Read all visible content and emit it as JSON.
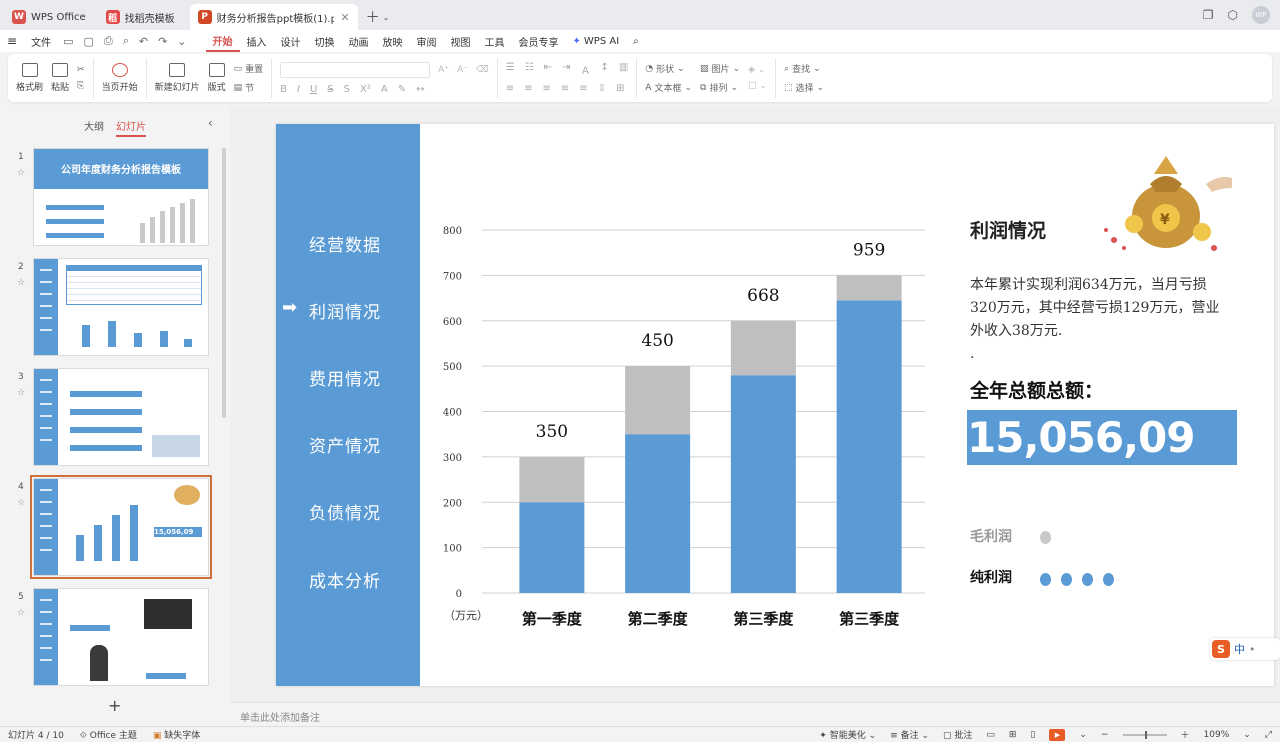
{
  "titlebar": {
    "tabs": [
      {
        "label": "WPS Office",
        "icon": "wps-logo-icon",
        "color": "#d9534f"
      },
      {
        "label": "找稻壳模板",
        "icon": "docer-icon",
        "color": "#e0484a"
      },
      {
        "label": "财务分析报告ppt模板(1).pptx",
        "icon": "presentation-icon",
        "color": "#d24726"
      }
    ]
  },
  "menubar": {
    "file": "文件",
    "items": [
      "开始",
      "插入",
      "设计",
      "切换",
      "动画",
      "放映",
      "审阅",
      "视图",
      "工具",
      "会员专享"
    ],
    "active": "开始",
    "wps_ai": "WPS AI"
  },
  "ribbon": {
    "format_painter": "格式刷",
    "paste": "粘贴",
    "from_current": "当页开始",
    "new_slide": "新建幻灯片",
    "layout": "版式",
    "section": "节",
    "reset": "重置",
    "shape": "形状",
    "picture": "图片",
    "textbox": "文本框",
    "arrange": "排列",
    "find": "查找",
    "select": "选择"
  },
  "leftpanel": {
    "tab_outline": "大纲",
    "tab_slides": "幻灯片",
    "thumbs": [
      {
        "num": "1",
        "title": "公司年度财务分析报告模板"
      },
      {
        "num": "2"
      },
      {
        "num": "3"
      },
      {
        "num": "4",
        "total": "15,056,09"
      },
      {
        "num": "5"
      }
    ],
    "add": "+"
  },
  "slide": {
    "nav": [
      "经营数据",
      "利润情况",
      "费用情况",
      "资产情况",
      "负债情况",
      "成本分析"
    ],
    "active_nav": 1,
    "right": {
      "title": "利润情况",
      "text": "本年累计实现利润634万元，当月亏损320万元，其中经营亏损129万元，营业外收入38万元.",
      "text_tail": ".",
      "total_label": "全年总额总额：",
      "total_value": "15,056,09",
      "legend_gross": "毛利润",
      "legend_net": "纯利润"
    }
  },
  "chart_data": {
    "type": "bar",
    "categories": [
      "第一季度",
      "第二季度",
      "第三季度",
      "第三季度"
    ],
    "series": [
      {
        "values": [
          200,
          350,
          480,
          645
        ],
        "color": "#5b9bd5"
      },
      {
        "values": [
          100,
          150,
          120,
          55
        ],
        "color": "#bfbfbf"
      }
    ],
    "data_labels": [
      "350",
      "450",
      "668",
      "959"
    ],
    "yticks": [
      0,
      100,
      200,
      300,
      400,
      500,
      600,
      700,
      800
    ],
    "ylim": [
      0,
      800
    ],
    "unit_label": "（万元）",
    "grid": true,
    "stacked": true
  },
  "notes": {
    "placeholder": "单击此处添加备注"
  },
  "statusbar": {
    "slide_info": "幻灯片 4 / 10",
    "theme": "Office 主题",
    "missing_font": "缺失字体",
    "smart_beautify": "智能美化",
    "notes": "备注",
    "comments": "批注",
    "zoom": "109%"
  },
  "ime": {
    "label": "中"
  }
}
